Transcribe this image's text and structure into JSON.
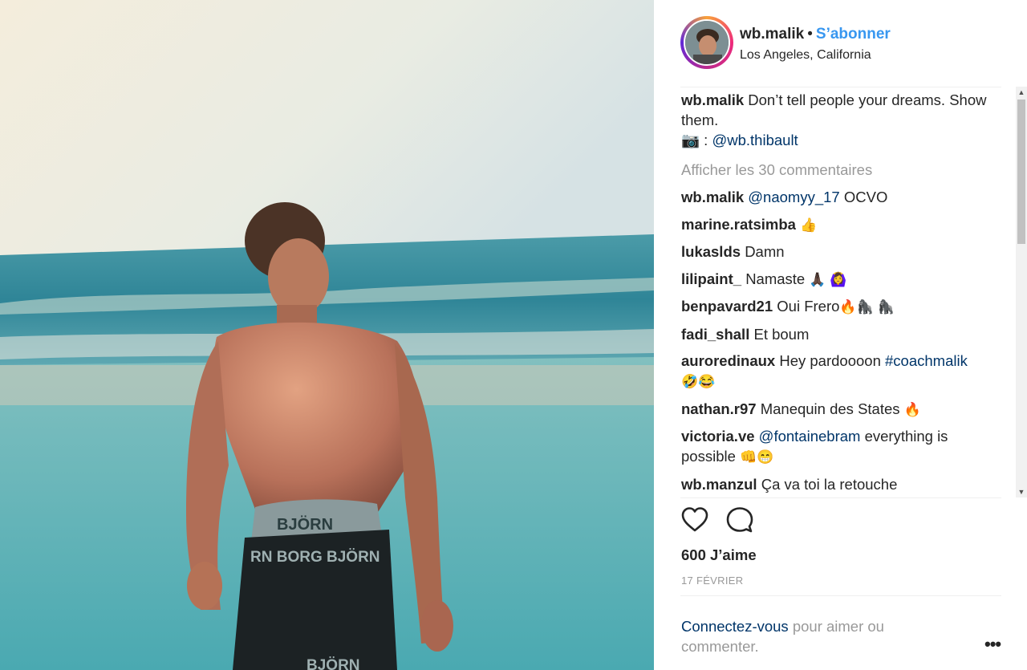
{
  "post": {
    "username": "wb.malik",
    "separator": "•",
    "follow_label": "S’abonner",
    "location": "Los Angeles, California",
    "caption_user": "wb.malik",
    "caption_text": "Don’t tell people your dreams. Show them.",
    "caption_camera": "📷 :",
    "caption_mention": "@wb.thibault",
    "view_all_comments": "Afficher les 30 commentaires",
    "likes": "600 J’aime",
    "date": "17 FÉVRIER",
    "login_link": "Connectez-vous",
    "login_text": "pour aimer ou commenter.",
    "more_label": "•••"
  },
  "photo": {
    "brand_text_1": "BJÖRN",
    "brand_text_2": "RN BORG BJÖRN",
    "brand_text_3": "BJÖRN"
  },
  "comments": [
    {
      "user": "wb.malik",
      "mention": "@naomyy_17",
      "text": "OCVO",
      "emoji": ""
    },
    {
      "user": "marine.ratsimba",
      "mention": "",
      "text": "",
      "emoji": "👍"
    },
    {
      "user": "lukaslds",
      "mention": "",
      "text": "Damn",
      "emoji": ""
    },
    {
      "user": "lilipaint_",
      "mention": "",
      "text": "Namaste",
      "emoji": "🙏🏿 🙆‍♀️"
    },
    {
      "user": "benpavard21",
      "mention": "",
      "text": "Oui Frero",
      "emoji": "🔥🦍 🦍"
    },
    {
      "user": "fadi_shall",
      "mention": "",
      "text": "Et boum",
      "emoji": ""
    },
    {
      "user": "auroredinaux",
      "mention": "#coachmalik",
      "text": "Hey pardoooon",
      "emoji": "🤣😂"
    },
    {
      "user": "nathan.r97",
      "mention": "",
      "text": "Manequin des States",
      "emoji": "🔥"
    },
    {
      "user": "victoria.ve",
      "mention": "@fontainebram",
      "text": "everything is possible",
      "emoji": "👊😁"
    },
    {
      "user": "wb.manzul",
      "mention": "",
      "text": "Ça va toi la retouche",
      "emoji": ""
    }
  ],
  "icons": {
    "like": "heart-icon",
    "comment": "comment-icon",
    "camera": "camera-icon",
    "more": "more-icon",
    "scroll_up": "chevron-up-icon",
    "scroll_down": "chevron-down-icon"
  },
  "colors": {
    "link_blue": "#3897f0",
    "mention_blue": "#003569",
    "muted_gray": "#999999",
    "text": "#262626"
  }
}
